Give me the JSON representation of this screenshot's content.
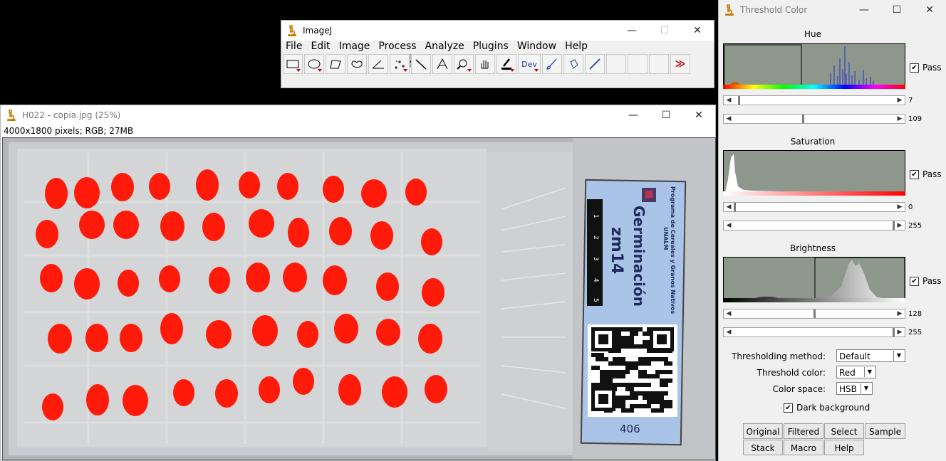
{
  "imagej": {
    "title": "ImageJ",
    "menu": [
      "File",
      "Edit",
      "Image",
      "Process",
      "Analyze",
      "Plugins",
      "Window",
      "Help"
    ],
    "dev_label": "Dev"
  },
  "image_window": {
    "title": "H022 - copia.jpg (25%)",
    "info": "4000x1800 pixels; RGB; 27MB",
    "label_card": {
      "program": "Programa de Cereales y Granos Nativos",
      "org": "UNALM",
      "heading": "Germinación",
      "code": "zm14",
      "number": "406",
      "ruler_marks": [
        "1",
        "2",
        "3",
        "4",
        "5"
      ]
    }
  },
  "threshold": {
    "title": "Threshold Color",
    "hue": {
      "label": "Hue",
      "pass_label": "Pass",
      "pass": true,
      "min": "7",
      "max": "109",
      "min_frac": 0.027,
      "max_frac": 0.43
    },
    "saturation": {
      "label": "Saturation",
      "pass_label": "Pass",
      "pass": true,
      "min": "0",
      "max": "255",
      "min_frac": 0.0,
      "max_frac": 1.0
    },
    "brightness": {
      "label": "Brightness",
      "pass_label": "Pass",
      "pass": true,
      "min": "128",
      "max": "255",
      "min_frac": 0.5,
      "max_frac": 1.0
    },
    "method_label": "Thresholding method:",
    "method": "Default",
    "color_label": "Threshold color:",
    "color": "Red",
    "space_label": "Color space:",
    "space": "HSB",
    "dark_bg_label": "Dark background",
    "dark_bg": true,
    "buttons": [
      "Original",
      "Filtered",
      "Select",
      "Sample",
      "Stack",
      "Macro",
      "Help"
    ]
  },
  "colors": {
    "blob": "#ff1a0a",
    "histogram_bg": "#8d978c"
  }
}
